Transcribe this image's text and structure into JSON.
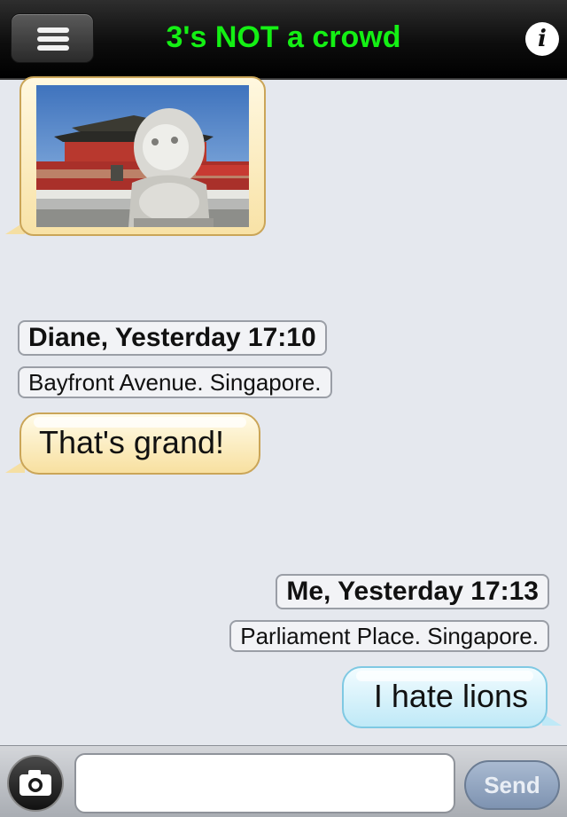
{
  "header": {
    "title": "3's NOT a crowd",
    "title_color": "#14f014",
    "menu_icon": "hamburger-menu-icon",
    "info_icon": "info-icon",
    "info_glyph": "i"
  },
  "messages": [
    {
      "type": "photo",
      "direction": "incoming",
      "image": "photo of stone lion statue in front of Tiananmen gate"
    },
    {
      "type": "text",
      "direction": "incoming",
      "sender_line": "Diane, Yesterday 17:10",
      "location": "Bayfront Avenue. Singapore.",
      "text": "That's grand!"
    },
    {
      "type": "text",
      "direction": "outgoing",
      "sender_line": "Me, Yesterday 17:13",
      "location": "Parliament Place. Singapore.",
      "text": "I hate lions"
    }
  ],
  "composer": {
    "camera_icon": "camera-icon",
    "input_value": "",
    "send_label": "Send"
  },
  "colors": {
    "incoming_bubble": "#f8e0a0",
    "outgoing_bubble": "#bfe9f7",
    "background": "#e5e8ee"
  }
}
